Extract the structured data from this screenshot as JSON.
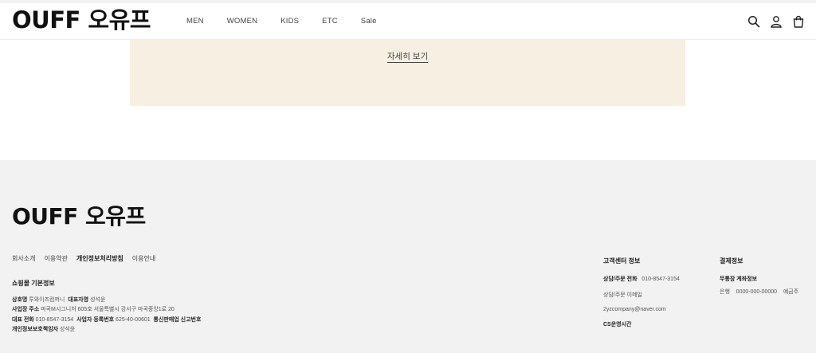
{
  "header": {
    "logo": "OUFF 오유프",
    "nav": [
      "MEN",
      "WOMEN",
      "KIDS",
      "ETC",
      "Sale"
    ],
    "icons": [
      "search-icon",
      "user-icon",
      "bag-icon"
    ]
  },
  "banner": {
    "link": "자세히 보기"
  },
  "footer": {
    "logo": "OUFF 오유프",
    "links": [
      "회사소개",
      "이용약관",
      "개인정보처리방침",
      "이용안내"
    ],
    "shop_info": {
      "title": "쇼핑몰 기본정보",
      "company_label": "상호명",
      "company": "투와이즈컴퍼니",
      "ceo_label": "대표자명",
      "ceo": "성석윤",
      "address_label": "사업장 주소",
      "address": "마곡M시그니처 605호 서울특별시 강서구 마곡중앙1로 20",
      "phone_label": "대표 전화",
      "phone": "010-8547-3154",
      "bizno_label": "사업자 등록번호",
      "bizno": "625-40-00601",
      "ecommerce_label": "통신판매업 신고번호",
      "privacy_label": "개인정보보호책임자",
      "privacy": "성석윤"
    },
    "cs": {
      "title": "고객센터 정보",
      "phone_label": "상담/주문 전화",
      "phone": "010-8547-3154",
      "email_label": "상담/주문 이메일",
      "email": "2yzcompany@naver.com",
      "hours_label": "CS운영시간"
    },
    "payment": {
      "title": "결제정보",
      "account_label": "무통장 계좌정보",
      "bank": "은행",
      "account_no": "0000-000-00000",
      "holder": "예금주"
    }
  }
}
